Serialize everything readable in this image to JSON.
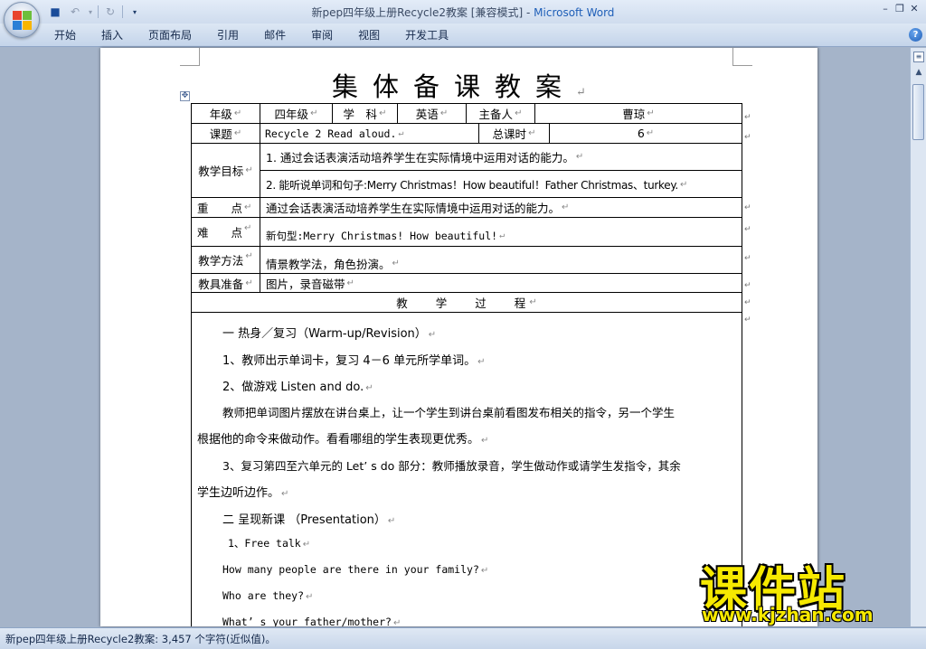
{
  "window": {
    "title_doc": "新pep四年级上册Recycle2教案 [兼容模式]",
    "title_sep": " - ",
    "title_app": "Microsoft Word",
    "minimize": "–",
    "restore": "❐",
    "close": "✕"
  },
  "ribbon": {
    "tabs": [
      "开始",
      "插入",
      "页面布局",
      "引用",
      "邮件",
      "审阅",
      "视图",
      "开发工具"
    ],
    "help": "?"
  },
  "doc": {
    "title": "集体备课教案",
    "table": {
      "grade_label": "年级",
      "grade_value": "四年级",
      "subject_label": "学　科",
      "subject_value": "英语",
      "lead_label": "主备人",
      "lead_value": "曹琼",
      "topic_label": "课题",
      "topic_value": "Recycle 2 Read aloud.",
      "hours_label": "总课时",
      "hours_value": "6",
      "goals_label": "教学目标",
      "goal_1": "1. 通过会话表演活动培养学生在实际情境中运用对话的能力。",
      "goal_2": "2. 能听说单词和句子:Merry Christmas！How beautiful！Father Christmas、turkey.",
      "key_label": "重　　点",
      "key_value": "通过会话表演活动培养学生在实际情境中运用对话的能力。",
      "difficult_label": "难　　点",
      "difficult_value": "新句型:Merry Christmas! How beautiful!",
      "method_label": "教学方法",
      "method_value": "情景教学法，角色扮演。",
      "tools_label": "教具准备",
      "tools_value": "图片，录音磁带",
      "process_label": "教　　学　　过　　程"
    },
    "body": {
      "p1": "一 热身／复习（Warm-up/Revision）",
      "p2": "1、教师出示单词卡，复习 4－6 单元所学单词。",
      "p3": "2、做游戏 Listen and do.",
      "p4a": "教师把单词图片摆放在讲台桌上，让一个学生到讲台桌前看图发布相关的指令，另一个学生",
      "p4b": "根据他的命令来做动作。看看哪组的学生表现更优秀。",
      "p5a": "3、复习第四至六单元的 Let’ s do 部分：教师播放录音，学生做动作或请学生发指令，其余",
      "p5b": "学生边听边作。",
      "p6": "二 呈现新课 （Presentation）",
      "p7": "1、Free talk",
      "p8": "How many people are there in your family?",
      "p9": "Who are they?",
      "p10": "What’ s your father/mother?"
    }
  },
  "status": {
    "text": "新pep四年级上册Recycle2教案: 3,457 个字符(近似值)。"
  },
  "watermark": {
    "main": "课件站",
    "url": "www.kjzhan.com"
  },
  "colors": {
    "ribbon_bg": "#c4d4ea",
    "workspace": "#a5b4c9",
    "title_app": "#1f5fb8",
    "watermark": "#f6e900"
  }
}
